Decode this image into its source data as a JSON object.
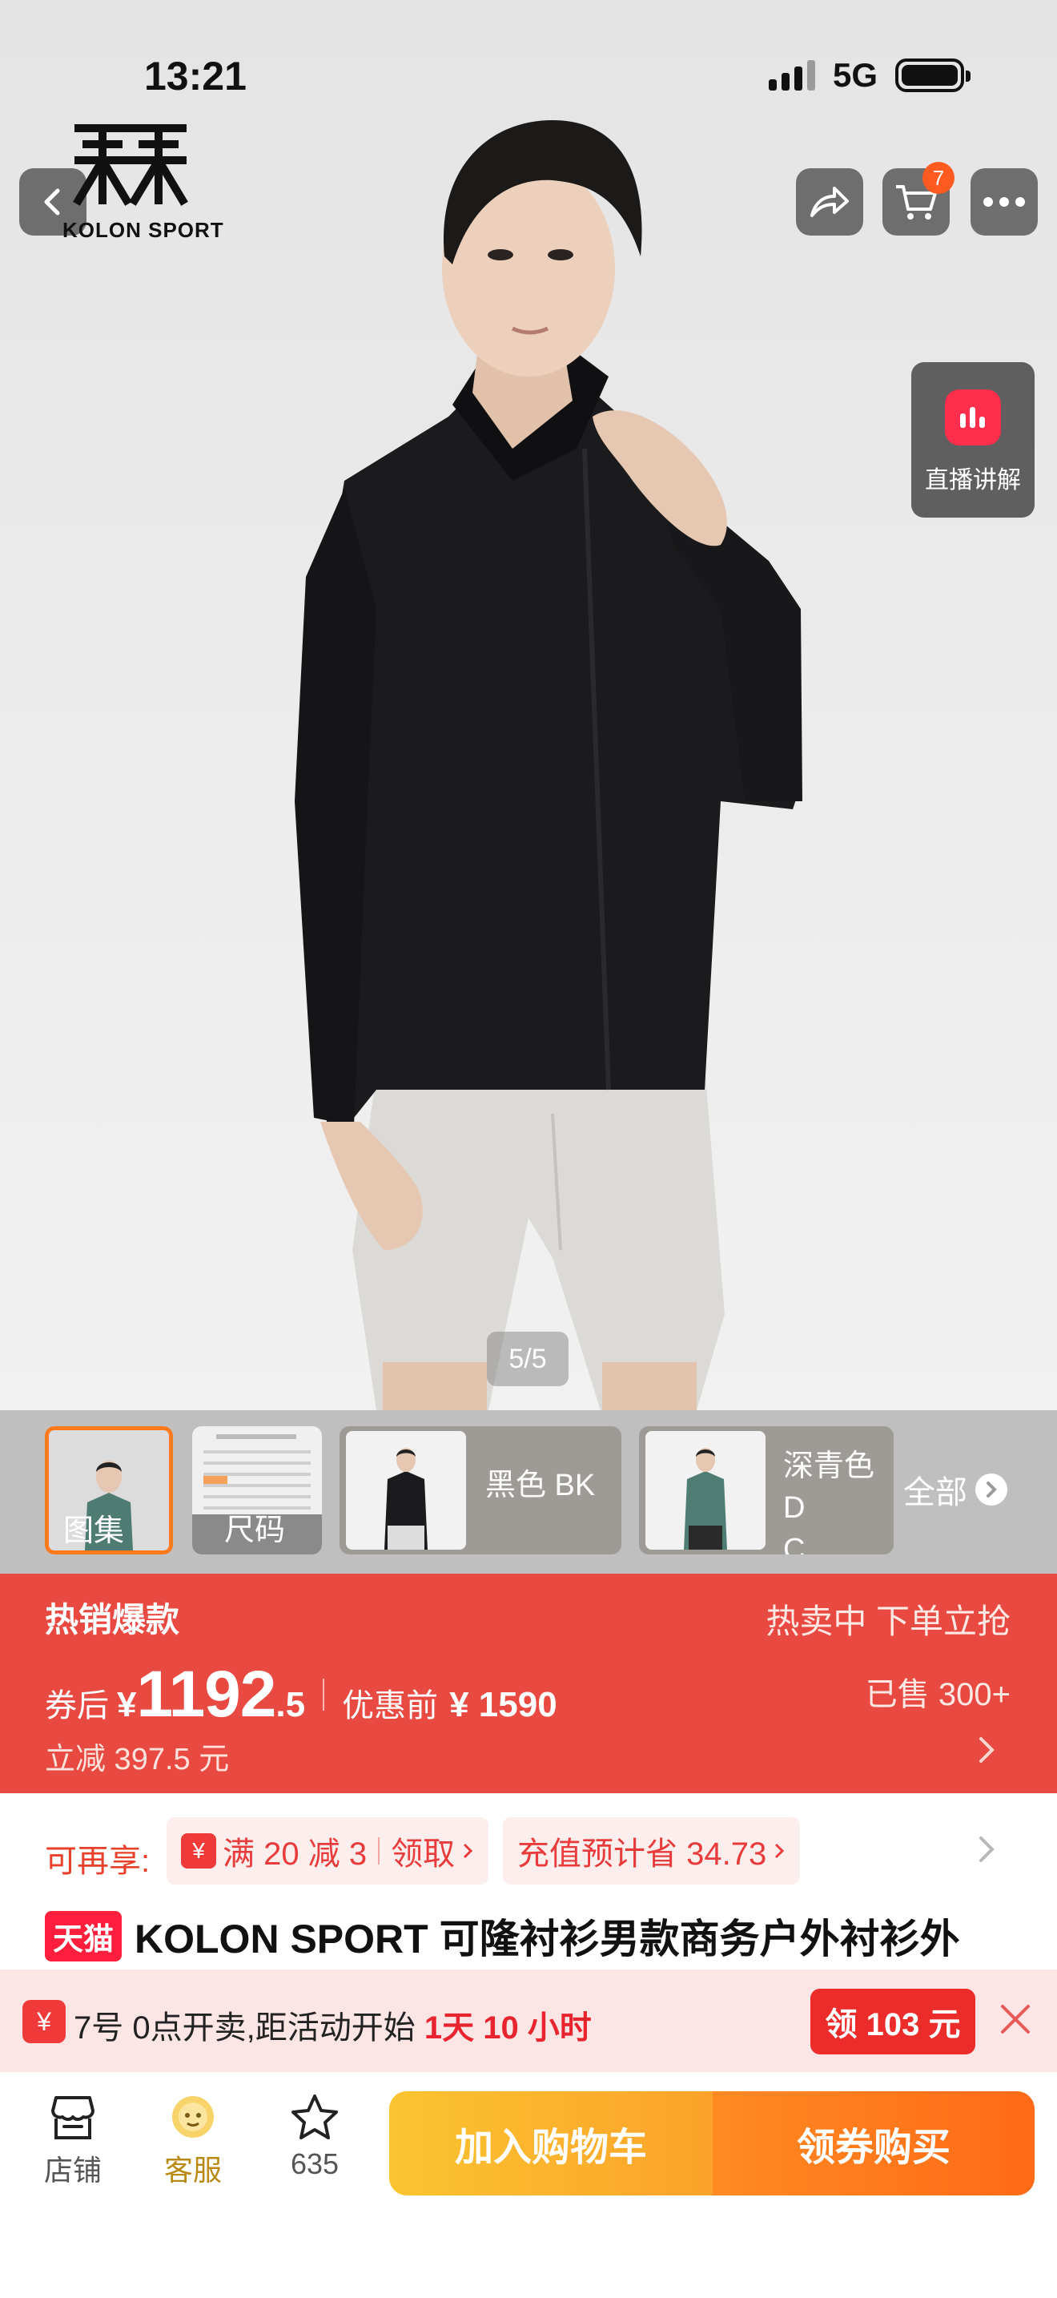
{
  "status_bar": {
    "time": "13:21",
    "network": "5G"
  },
  "brand": {
    "logo_text": "KOLON SPORT"
  },
  "header": {
    "cart_count": "7"
  },
  "live": {
    "label": "直播讲解"
  },
  "gallery": {
    "page_indicator": "5/5"
  },
  "thumbnails": {
    "items": [
      {
        "label": "图集"
      },
      {
        "label": "尺码"
      },
      {
        "label": "黑色 BK"
      },
      {
        "label_line1": "深青色 D",
        "label_line2": "C"
      }
    ],
    "all_label": "全部"
  },
  "price": {
    "hot_title": "热销爆款",
    "hot_right": "热卖中 下单立抢",
    "prefix": "券后",
    "currency": "¥",
    "integer": "1192",
    "decimal": ".5",
    "original_label": "优惠前",
    "original_price": "¥ 1590",
    "sold": "已售 300+",
    "reduce": "立减 397.5 元"
  },
  "coupons": {
    "label": "可再享:",
    "coupon1_text": "满 20 减 3",
    "coupon1_action": "领取",
    "coupon2_text": "充值预计省 34.73"
  },
  "product": {
    "badge": "天猫",
    "title": "KOLON SPORT 可隆衬衫男款商务户外衬衫外"
  },
  "presale": {
    "text_before": "7号 0点开卖,距活动开始",
    "countdown": "1天 10 小时",
    "claim_label": "领 103 元"
  },
  "bottom": {
    "store_label": "店铺",
    "service_label": "客服",
    "favorite_count": "635",
    "add_cart_label": "加入购物车",
    "buy_label": "领券购买"
  },
  "colors": {
    "banner_red": "#e84a42",
    "accent_orange": "#ff7a1a",
    "cta_yellow": "#fbc431",
    "cta_orange": "#ff6a16",
    "tmall_red": "#ff1e3c"
  },
  "icons": [
    "back-icon",
    "share-icon",
    "cart-icon",
    "more-icon",
    "live-chart-icon",
    "chevron-right-icon",
    "coupon-icon",
    "close-icon",
    "store-icon",
    "service-icon",
    "star-icon"
  ]
}
